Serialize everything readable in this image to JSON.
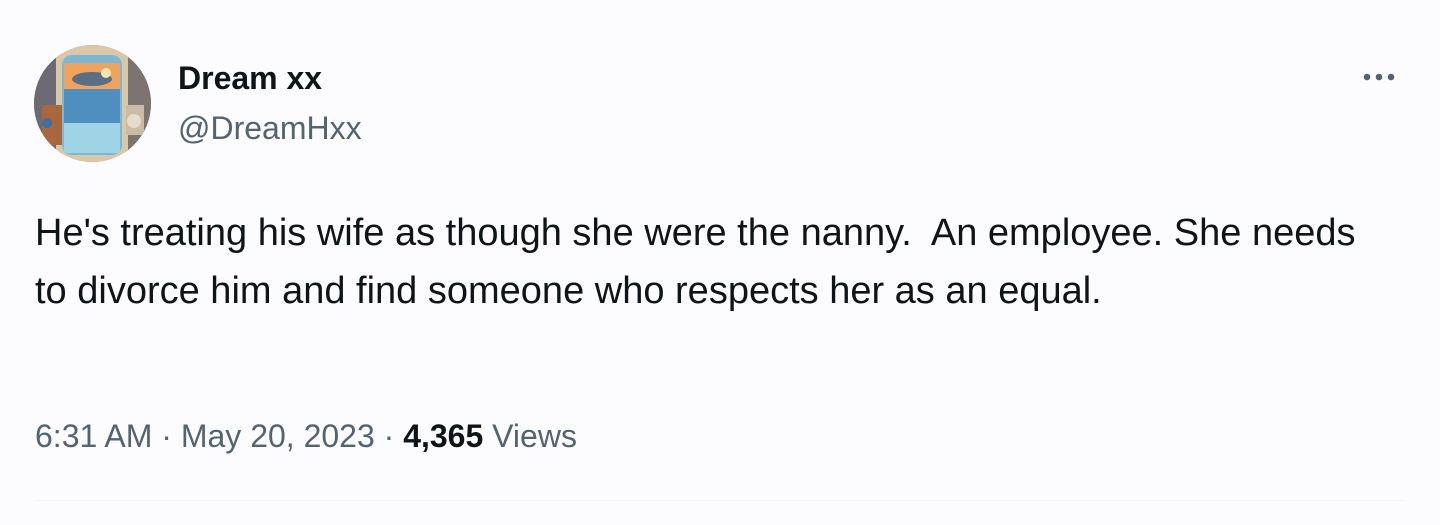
{
  "tweet": {
    "author": {
      "display_name": "Dream xx",
      "handle": "@DreamHxx",
      "avatar_icon": "avatar-photo"
    },
    "more_icon": "more-options-icon",
    "text": "He's treating his wife as though she were the nanny.  An employee. She needs to divorce him and find someone who respects her as an equal.",
    "time": "6:31 AM",
    "separator": "·",
    "date": "May 20, 2023",
    "views_count": "4,365",
    "views_label": "Views"
  },
  "colors": {
    "background": "#fcfbfd",
    "text_primary": "#0f1419",
    "text_secondary": "#536471",
    "divider": "#eff3f4"
  }
}
